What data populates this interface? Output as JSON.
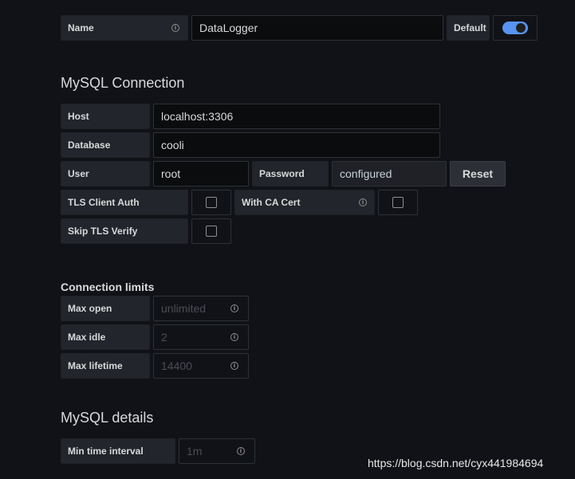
{
  "name_row": {
    "label": "Name",
    "value": "DataLogger",
    "default_label": "Default",
    "default_enabled": true
  },
  "mysql_connection": {
    "title": "MySQL Connection",
    "host_label": "Host",
    "host_value": "localhost:3306",
    "database_label": "Database",
    "database_value": "cooli",
    "user_label": "User",
    "user_value": "root",
    "password_label": "Password",
    "password_value": "configured",
    "reset_label": "Reset",
    "tls_client_auth_label": "TLS Client Auth",
    "with_ca_cert_label": "With CA Cert",
    "skip_tls_verify_label": "Skip TLS Verify"
  },
  "connection_limits": {
    "title": "Connection limits",
    "max_open_label": "Max open",
    "max_open_placeholder": "unlimited",
    "max_idle_label": "Max idle",
    "max_idle_placeholder": "2",
    "max_lifetime_label": "Max lifetime",
    "max_lifetime_placeholder": "14400"
  },
  "mysql_details": {
    "title": "MySQL details",
    "min_time_interval_label": "Min time interval",
    "min_time_interval_placeholder": "1m"
  },
  "watermark": "https://blog.csdn.net/cyx441984694",
  "colors": {
    "background": "#111217",
    "toggle_on": "#5794f2"
  }
}
